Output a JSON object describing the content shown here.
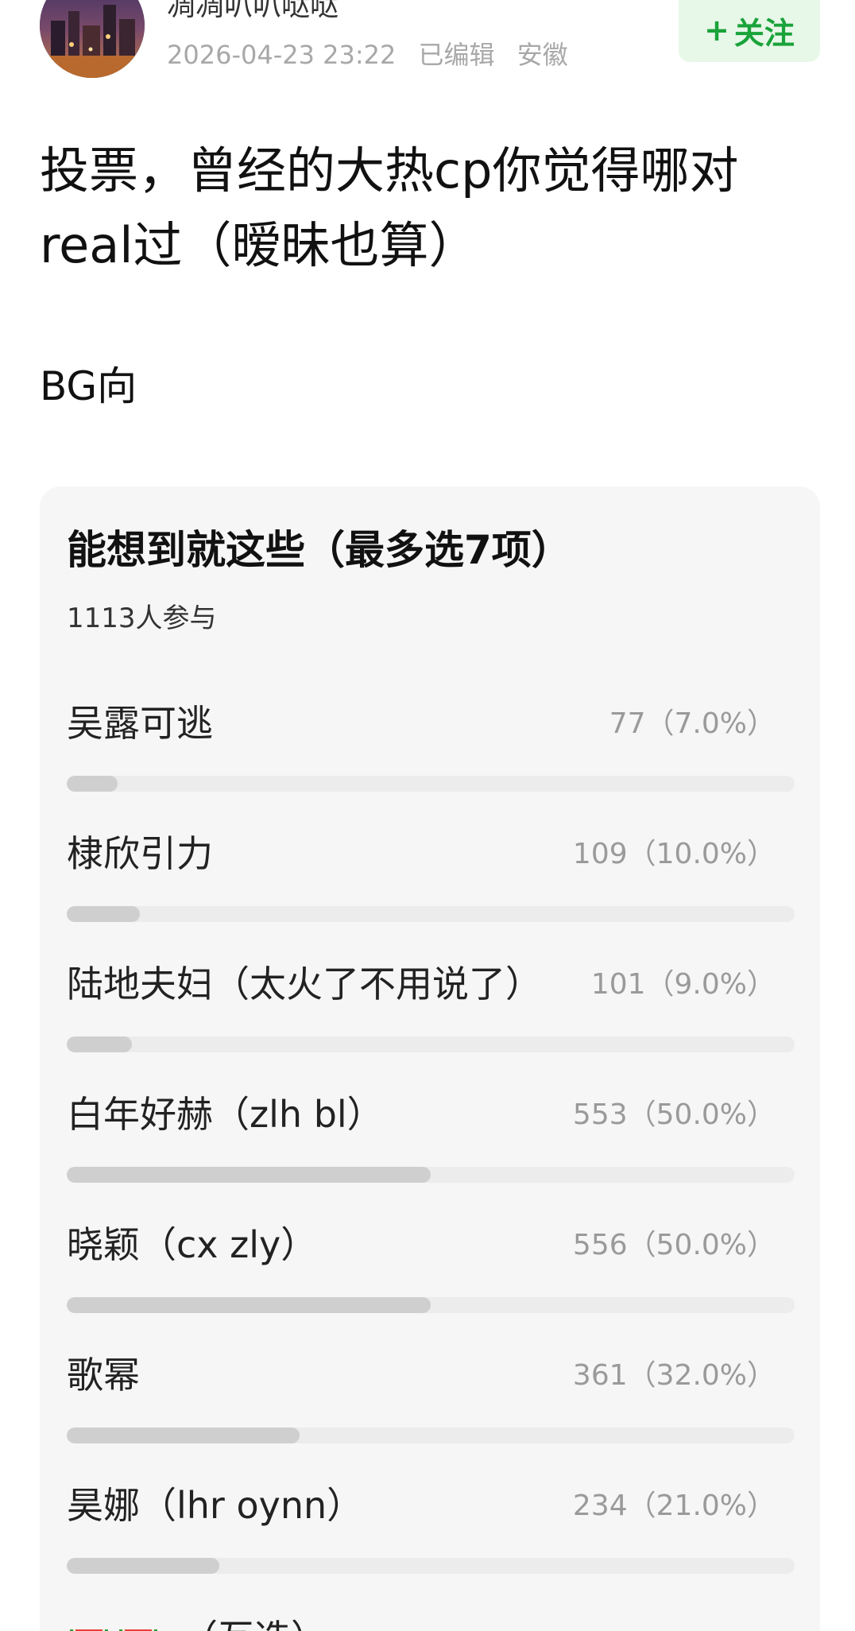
{
  "header": {
    "username": "凋凋叭叭哒哒",
    "timestamp": "2026-04-23 23:22",
    "edited": "已编辑",
    "location": "安徽",
    "follow_plus": "+",
    "follow_label": "关注"
  },
  "post": {
    "title": "投票，曾经的大热cp你觉得哪对real过（暧昧也算）",
    "body": "BG向"
  },
  "poll": {
    "title": "能想到就这些（最多选7项）",
    "participants": "1113人参与",
    "options": [
      {
        "label": "吴露可逃",
        "votes": "77（7.0%）",
        "fraction": 0.07
      },
      {
        "label": "棣欣引力",
        "votes": "109（10.0%）",
        "fraction": 0.1
      },
      {
        "label": "陆地夫妇（太火了不用说了）",
        "votes": "101（9.0%）",
        "fraction": 0.09
      },
      {
        "label": "白年好赫（zlh bl）",
        "votes": "553（50.0%）",
        "fraction": 0.5
      },
      {
        "label": "晓颖（cx zly）",
        "votes": "556（50.0%）",
        "fraction": 0.5
      },
      {
        "label": "歌幂",
        "votes": "361（32.0%）",
        "fraction": 0.32
      },
      {
        "label": "昊娜（lhr oynn）",
        "votes": "234（21.0%）",
        "fraction": 0.21
      }
    ],
    "partial_option_label": "（互选）",
    "partial_option_icon": "watermelon-icon"
  },
  "colors": {
    "follow_text": "#19a33a",
    "follow_bg": "#e7f7e8",
    "bar_track": "#ececec",
    "bar_fill": "#cfcfcf",
    "card_bg": "#f6f6f6"
  }
}
